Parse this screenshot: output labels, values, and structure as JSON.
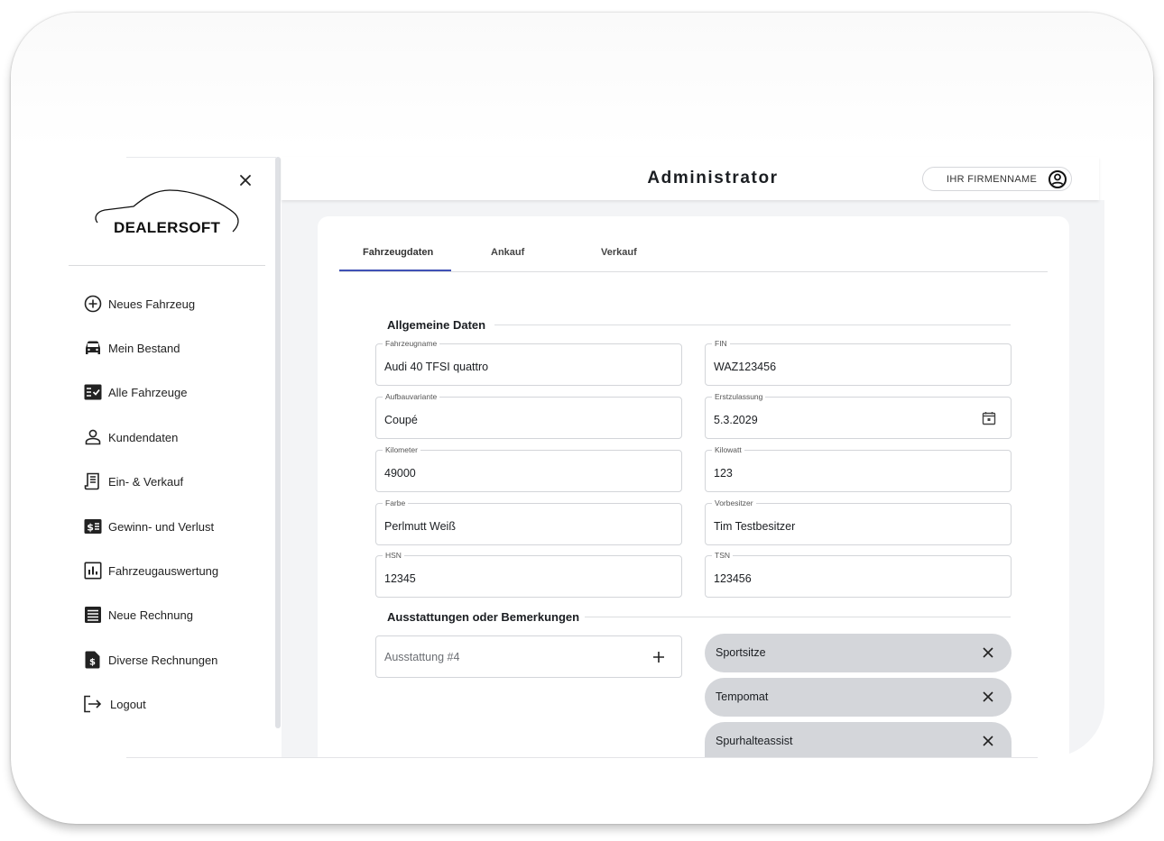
{
  "brand": {
    "logo_text": "DEALERSOFT"
  },
  "header": {
    "title": "Administrator",
    "company_button": "IHR FIRMENNAME"
  },
  "sidebar": {
    "items": [
      {
        "label": "Neues Fahrzeug",
        "icon": "add-circle-icon"
      },
      {
        "label": "Mein Bestand",
        "icon": "car-icon"
      },
      {
        "label": "Alle Fahrzeuge",
        "icon": "checklist-icon"
      },
      {
        "label": "Kundendaten",
        "icon": "person-icon"
      },
      {
        "label": "Ein- & Verkauf",
        "icon": "receipt-icon"
      },
      {
        "label": "Gewinn- und Verlust",
        "icon": "money-icon"
      },
      {
        "label": "Fahrzeugauswertung",
        "icon": "bar-chart-icon"
      },
      {
        "label": "Neue Rechnung",
        "icon": "list-document-icon"
      },
      {
        "label": "Diverse Rechnungen",
        "icon": "invoice-icon"
      },
      {
        "label": "Logout",
        "icon": "logout-icon"
      }
    ]
  },
  "tabs": [
    {
      "label": "Fahrzeugdaten",
      "active": true
    },
    {
      "label": "Ankauf",
      "active": false
    },
    {
      "label": "Verkauf",
      "active": false
    }
  ],
  "general": {
    "title": "Allgemeine Daten",
    "fields": {
      "fahrzeugname": {
        "label": "Fahrzeugname",
        "value": "Audi 40 TFSI quattro"
      },
      "fin": {
        "label": "FIN",
        "value": "WAZ123456"
      },
      "aufbauvariante": {
        "label": "Aufbauvariante",
        "value": "Coupé"
      },
      "erstzulassung": {
        "label": "Erstzulassung",
        "value": "5.3.2029"
      },
      "kilometer": {
        "label": "Kilometer",
        "value": "49000"
      },
      "kilowatt": {
        "label": "Kilowatt",
        "value": "123"
      },
      "farbe": {
        "label": "Farbe",
        "value": "Perlmutt Weiß"
      },
      "vorbesitzer": {
        "label": "Vorbesitzer",
        "value": "Tim Testbesitzer"
      },
      "hsn": {
        "label": "HSN",
        "value": "12345"
      },
      "tsn": {
        "label": "TSN",
        "value": "123456"
      }
    }
  },
  "equipment": {
    "title": "Ausstattungen oder Bemerkungen",
    "input_placeholder": "Ausstattung #4",
    "chips": [
      "Sportsitze",
      "Tempomat",
      "Spurhalteassist"
    ]
  },
  "colors": {
    "accent": "#3f51b5",
    "chip_bg": "#d4d6da",
    "content_bg": "#f3f4f6"
  }
}
